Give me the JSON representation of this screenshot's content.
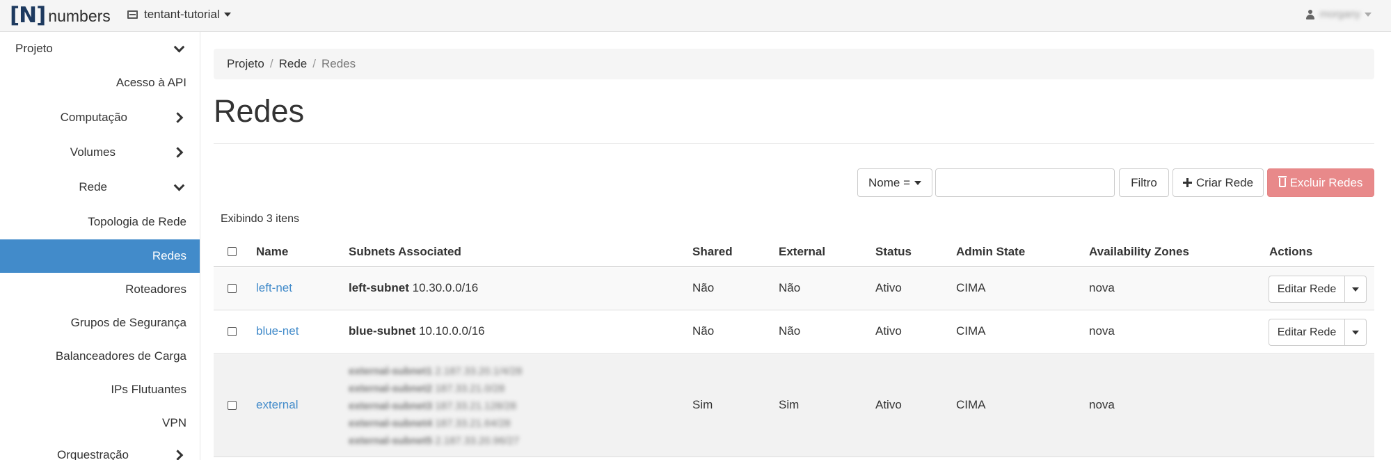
{
  "navbar": {
    "brand_mark": "[N]",
    "brand_word": "numbers",
    "project_name": "tentant-tutorial",
    "user_name": "morgany"
  },
  "sidebar": {
    "items": [
      {
        "label": "Projeto",
        "chevron": "down"
      },
      {
        "label": "Acesso à API"
      },
      {
        "label": "Computação",
        "chevron": "right"
      },
      {
        "label": "Volumes",
        "chevron": "right"
      },
      {
        "label": "Rede",
        "chevron": "down"
      },
      {
        "label": "Topologia de Rede"
      },
      {
        "label": "Redes",
        "active": true
      },
      {
        "label": "Roteadores"
      },
      {
        "label": "Grupos de Segurança"
      },
      {
        "label": "Balanceadores de Carga"
      },
      {
        "label": "IPs Flutuantes"
      },
      {
        "label": "VPN"
      },
      {
        "label": "Orquestração",
        "chevron": "right"
      }
    ]
  },
  "breadcrumb": {
    "items": [
      "Projeto",
      "Rede",
      "Redes"
    ],
    "separator": "/"
  },
  "page": {
    "title": "Redes"
  },
  "toolbar": {
    "filter_select": "Nome =",
    "filter_input_value": "",
    "filter_button": "Filtro",
    "create_button": "Criar Rede",
    "delete_button": "Excluir Redes"
  },
  "table": {
    "count_text": "Exibindo 3 itens",
    "columns": [
      "Name",
      "Subnets Associated",
      "Shared",
      "External",
      "Status",
      "Admin State",
      "Availability Zones",
      "Actions"
    ],
    "rows": [
      {
        "name": "left-net",
        "subnet_name": "left-subnet",
        "subnet_cidr": "10.30.0.0/16",
        "shared": "Não",
        "external": "Não",
        "status": "Ativo",
        "admin_state": "CIMA",
        "zones": "nova",
        "action": "Editar Rede"
      },
      {
        "name": "blue-net",
        "subnet_name": "blue-subnet",
        "subnet_cidr": "10.10.0.0/16",
        "shared": "Não",
        "external": "Não",
        "status": "Ativo",
        "admin_state": "CIMA",
        "zones": "nova",
        "action": "Editar Rede"
      },
      {
        "name": "external",
        "subnets_blurred": [
          {
            "name": "external-subnet1",
            "cidr": "2.187.33.20.1/4/28"
          },
          {
            "name": "external-subnet2",
            "cidr": "187.33.21.0/28"
          },
          {
            "name": "external-subnet3",
            "cidr": "187.33.21.128/28"
          },
          {
            "name": "external-subnet4",
            "cidr": "187.33.21.64/28"
          },
          {
            "name": "external-subnet5",
            "cidr": "2.187.33.20.96/27"
          }
        ],
        "shared": "Sim",
        "external": "Sim",
        "status": "Ativo",
        "admin_state": "CIMA",
        "zones": "nova"
      }
    ]
  },
  "colors": {
    "accent": "#428bca",
    "danger": "#e8898a",
    "sidebar_active": "#428bca"
  }
}
